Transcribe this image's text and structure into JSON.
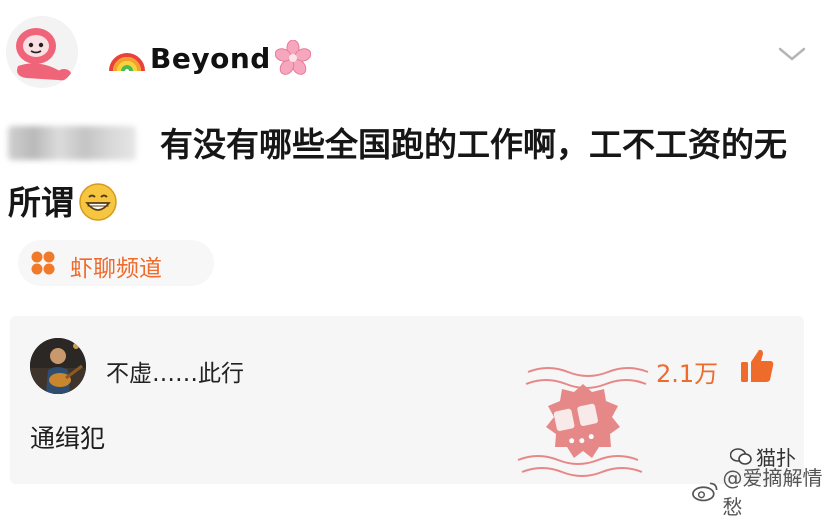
{
  "post": {
    "author": {
      "name_prefix_icon": "rainbow-icon",
      "name": "Beyond",
      "name_suffix_icon": "sakura-icon"
    },
    "text_line": "有没有哪些全国跑的工作啊，工不工资的无所谓",
    "emoji": "grinning-face-icon",
    "channel": {
      "icon": "four-dots-icon",
      "label": "虾聊频道"
    }
  },
  "comment": {
    "author": "不虚……此行",
    "text": "通缉犯",
    "likes": "2.1万",
    "like_icon": "thumbs-up-icon",
    "stamp_label": "神评"
  },
  "watermarks": {
    "wechat_label": "猫扑",
    "weibo_label": "@爱摘解情愁"
  },
  "colors": {
    "accent": "#ef6b2c",
    "stamp": "#e25a5a",
    "card_bg": "#f6f6f6"
  }
}
